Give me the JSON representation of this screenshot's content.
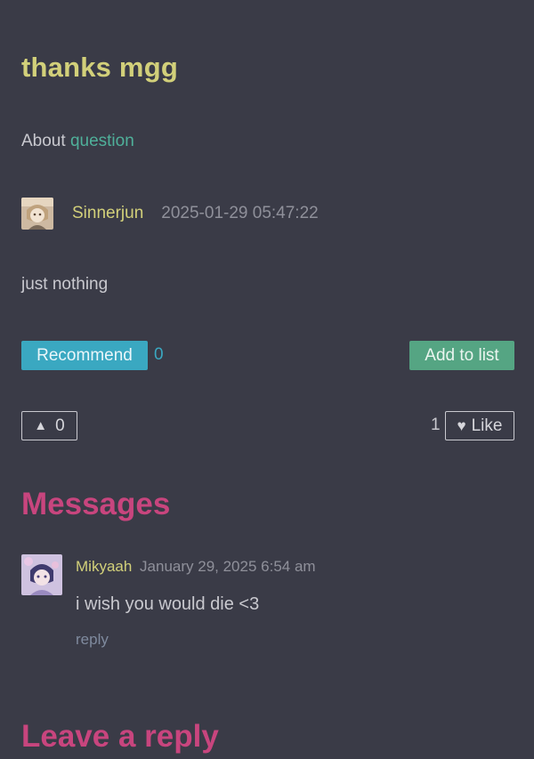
{
  "post": {
    "title": "thanks mgg",
    "about_prefix": "About",
    "about_link": "question",
    "author": "Sinnerjun",
    "date": "2025-01-29 05:47:22",
    "body": "just nothing"
  },
  "actions": {
    "recommend_label": "Recommend",
    "recommend_count": "0",
    "add_to_list_label": "Add to list",
    "vote_count": "0",
    "like_count": "1",
    "like_label": "Like"
  },
  "icons": {
    "vote": "up-triangle-icon",
    "like": "heart-icon"
  },
  "messages": {
    "heading": "Messages",
    "items": [
      {
        "author": "Mikyaah",
        "date": "January 29, 2025 6:54 am",
        "text": "i wish you would die <3",
        "reply_label": "reply"
      }
    ]
  },
  "leave_reply": {
    "heading": "Leave a reply"
  },
  "colors": {
    "background": "#3a3b47",
    "title": "#d2d07a",
    "link": "#4fb09a",
    "recommend": "#3aa8c1",
    "add_to_list": "#55a583",
    "heading": "#c8457e"
  }
}
